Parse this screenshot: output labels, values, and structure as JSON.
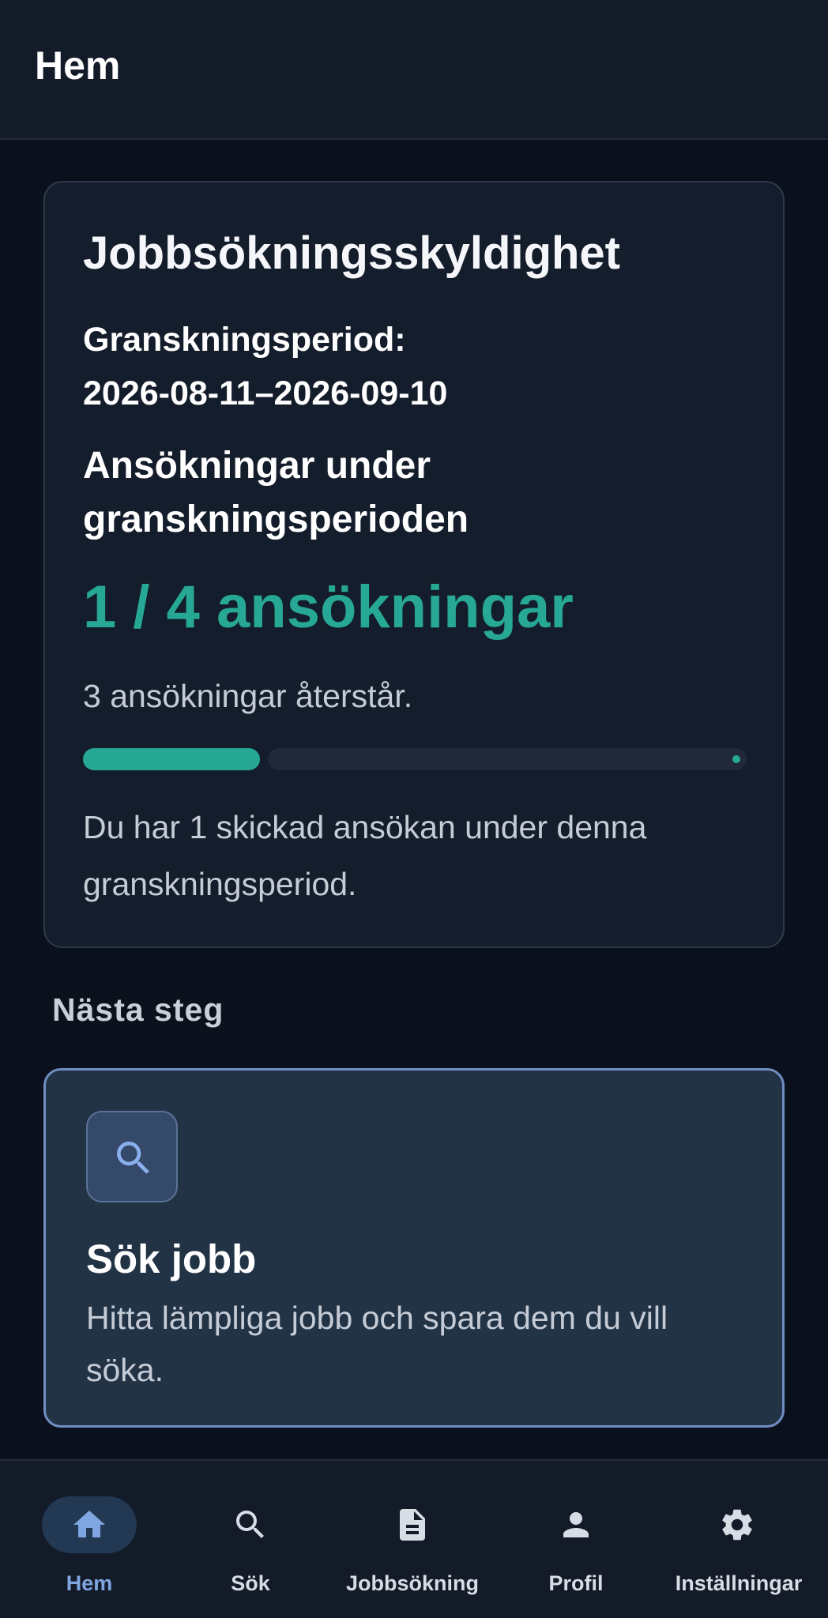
{
  "header": {
    "title": "Hem"
  },
  "obligation": {
    "title": "Jobbsökningsskyldighet",
    "period_label": "Granskningsperiod:",
    "period_value": "2026-08-11–2026-09-10",
    "applications_heading": "Ansökningar under granskningsperioden",
    "applications_count": "1 / 4 ansökningar",
    "remaining": "3 ansökningar återstår.",
    "progress": {
      "done": 1,
      "required": 4,
      "fraction": 0.25
    },
    "summary": "Du har 1 skickad ansökan under denna granskningsperiod."
  },
  "next_steps": {
    "label": "Nästa steg",
    "card": {
      "icon": "search-icon",
      "title": "Sök jobb",
      "description": "Hitta lämpliga jobb och spara dem du vill söka."
    }
  },
  "nav": {
    "items": [
      {
        "label": "Hem",
        "icon": "home-icon",
        "active": true
      },
      {
        "label": "Sök",
        "icon": "search-icon",
        "active": false
      },
      {
        "label": "Jobbsökning",
        "icon": "document-icon",
        "active": false
      },
      {
        "label": "Profil",
        "icon": "person-icon",
        "active": false
      },
      {
        "label": "Inställningar",
        "icon": "gear-icon",
        "active": false
      }
    ]
  },
  "colors": {
    "accent": "#27a894",
    "active_nav": "#7fa6e0",
    "card_border": "#6f8ec2",
    "background": "#0b111c"
  }
}
